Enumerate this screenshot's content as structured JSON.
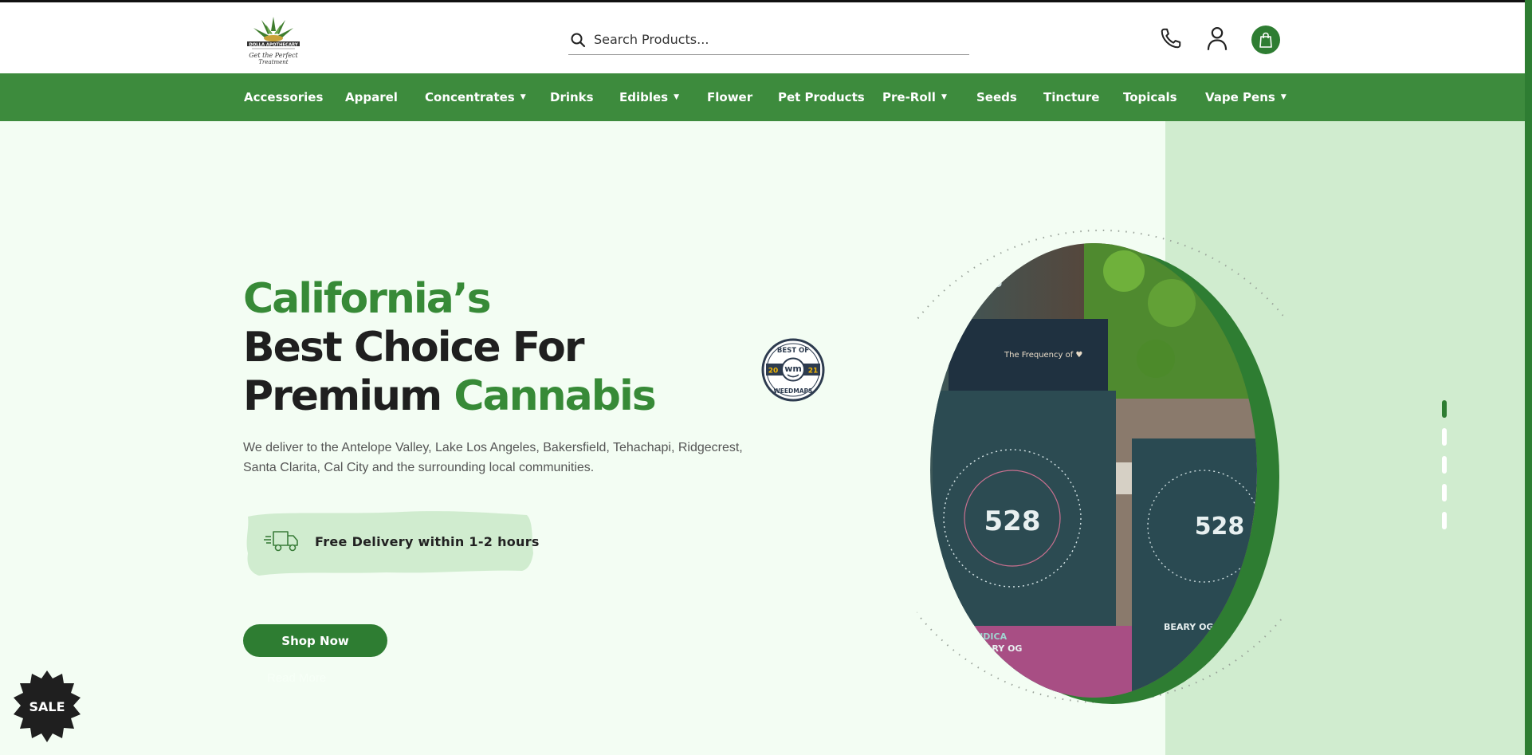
{
  "header": {
    "logo_text": "DOLLA APOTHECARY",
    "logo_tagline": "Get the Perfect Treatment",
    "search_placeholder": "Search Products...",
    "phone_icon": "phone-icon",
    "account_icon": "user-icon",
    "cart_icon": "shopping-bag-icon"
  },
  "nav": {
    "items": [
      {
        "label": "Accessories",
        "has_dropdown": false
      },
      {
        "label": "Apparel",
        "has_dropdown": false
      },
      {
        "label": "Concentrates",
        "has_dropdown": true
      },
      {
        "label": "Drinks",
        "has_dropdown": false
      },
      {
        "label": "Edibles",
        "has_dropdown": true
      },
      {
        "label": "Flower",
        "has_dropdown": false
      },
      {
        "label": "Pet Products",
        "has_dropdown": false
      },
      {
        "label": "Pre-Roll",
        "has_dropdown": true
      },
      {
        "label": "Seeds",
        "has_dropdown": false
      },
      {
        "label": "Tincture",
        "has_dropdown": false
      },
      {
        "label": "Topicals",
        "has_dropdown": false
      },
      {
        "label": "Vape Pens",
        "has_dropdown": true
      }
    ],
    "chevron": "⌄"
  },
  "hero": {
    "line1": "California’s",
    "line2": "Best Choice For",
    "line3_dark": "Premium ",
    "line3_green": "Cannabis",
    "description": "We deliver to the Antelope Valley, Lake Los Angeles, Bakersfield, Tehachapi, Ridgecrest, Santa Clarita, Cal City and the surrounding local communities.",
    "delivery_text": "Free Delivery within 1-2 hours",
    "shop_button": "Shop Now",
    "secondary_link": "Read More"
  },
  "badge": {
    "top": "BEST OF",
    "left": "20",
    "center": "wm",
    "right": "21",
    "bottom": "WEEDMAPS"
  },
  "sale_badge": "SALE",
  "product_image": {
    "brand": "528",
    "tagline": "The Frequency of ♥",
    "strain_type": "INDICA",
    "strain_name": "BEARY OG"
  },
  "slider": {
    "count": 5,
    "active_index": 0
  },
  "colors": {
    "brand_green": "#2e7d32",
    "nav_green": "#3d8b3d",
    "page_bg": "#f3fdf3",
    "band": "#d0eccf"
  }
}
